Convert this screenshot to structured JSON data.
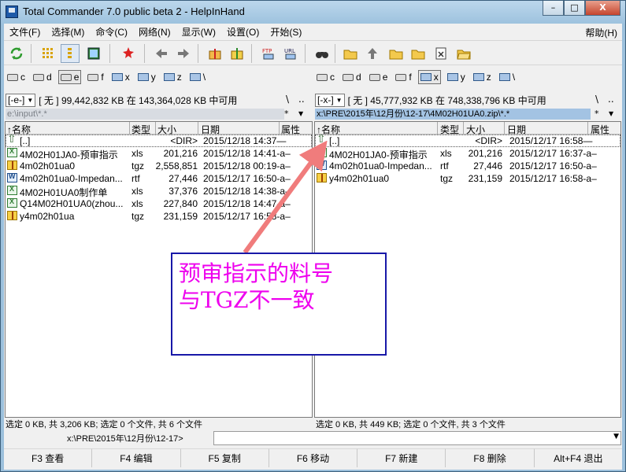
{
  "window": {
    "title": "Total Commander 7.0 public beta 2 - HelpInHand",
    "controls": {
      "minimize": "–",
      "maximize": "□",
      "close": "X"
    }
  },
  "menu": {
    "items": [
      "文件(F)",
      "选择(M)",
      "命令(C)",
      "网络(N)",
      "显示(W)",
      "设置(O)",
      "开始(S)"
    ],
    "help": "帮助(H)"
  },
  "toolbar": {
    "icons": [
      "refresh-icon",
      "brief-view-icon",
      "full-view-icon",
      "thumbnail-icon",
      "select-files-icon",
      "back-icon",
      "forward-icon",
      "pack-icon",
      "unpack-icon",
      "ftp-connect-icon",
      "url-icon",
      "find-files-icon",
      "folder-1-icon",
      "folder-up-icon",
      "folder-2-icon",
      "folder-3-icon",
      "notepad-icon",
      "folder-open-icon"
    ],
    "ftp_label": "FTP",
    "url_label": "URL"
  },
  "left": {
    "drives": [
      "c",
      "d",
      "e",
      "f",
      "x",
      "y",
      "z",
      "\\"
    ],
    "active_drive": "e",
    "drive_combo": "[-e-]",
    "volume": "[ 无 ]",
    "free_space": "99,442,832 KB 在 143,364,028 KB 中可用",
    "backslash": "\\",
    "dotdot": "..",
    "path": "e:\\input\\*.*",
    "star": "*",
    "columns": {
      "name": "↑名称",
      "type": "类型",
      "size": "大小",
      "date": "日期",
      "attr": "属性"
    },
    "files": [
      {
        "name": "[..]",
        "type": "",
        "size": "<DIR>",
        "date": "2015/12/18 14:37—",
        "icon": "up"
      },
      {
        "name": "4M02H01JA0-预审指示",
        "type": "xls",
        "size": "201,216",
        "date": "2015/12/18 14:41-a–",
        "icon": "xls"
      },
      {
        "name": "4m02h01ua0",
        "type": "tgz",
        "size": "2,558,851",
        "date": "2015/12/18 00:19-a–",
        "icon": "tgz"
      },
      {
        "name": "4m02h01ua0-Impedan...",
        "type": "rtf",
        "size": "27,446",
        "date": "2015/12/17 16:50-a–",
        "icon": "rtf"
      },
      {
        "name": "4M02H01UA0制作单",
        "type": "xls",
        "size": "37,376",
        "date": "2015/12/18 14:38-a–",
        "icon": "xls"
      },
      {
        "name": "Q14M02H01UA0(zhou...",
        "type": "xls",
        "size": "227,840",
        "date": "2015/12/18 14:47-a–",
        "icon": "xls"
      },
      {
        "name": "y4m02h01ua",
        "type": "tgz",
        "size": "231,159",
        "date": "2015/12/17 16:58-a–",
        "icon": "tgz"
      }
    ],
    "status": "选定 0 KB, 共 3,206 KB; 选定 0 个文件, 共 6 个文件"
  },
  "right": {
    "drives": [
      "c",
      "d",
      "e",
      "f",
      "x",
      "y",
      "z",
      "\\"
    ],
    "active_drive": "x",
    "drive_combo": "[-x-]",
    "volume": "[ 无 ]",
    "free_space": "45,777,932 KB 在 748,338,796 KB 中可用",
    "backslash": "\\",
    "dotdot": "..",
    "path": "x:\\PRE\\2015年\\12月份\\12-17\\4M02H01UA0.zip\\*.*",
    "star": "*",
    "columns": {
      "name": "↑名称",
      "type": "类型",
      "size": "大小",
      "date": "日期",
      "attr": "属性"
    },
    "files": [
      {
        "name": "[..]",
        "type": "",
        "size": "<DIR>",
        "date": "2015/12/17 16:58—",
        "icon": "up"
      },
      {
        "name": "4M02H01JA0-预审指示",
        "type": "xls",
        "size": "201,216",
        "date": "2015/12/17 16:37-a–",
        "icon": "xls"
      },
      {
        "name": "4m02h01ua0-Impedan...",
        "type": "rtf",
        "size": "27,446",
        "date": "2015/12/17 16:50-a–",
        "icon": "rtf"
      },
      {
        "name": "y4m02h01ua0",
        "type": "tgz",
        "size": "231,159",
        "date": "2015/12/17 16:58-a–",
        "icon": "tgz"
      }
    ],
    "status": "选定 0 KB, 共 449 KB; 选定 0 个文件, 共 3 个文件"
  },
  "command": {
    "path": "x:\\PRE\\2015年\\12月份\\12-17>",
    "value": ""
  },
  "fkeys": [
    "F3 查看",
    "F4 编辑",
    "F5 复制",
    "F6 移动",
    "F7 新建",
    "F8 删除",
    "Alt+F4 退出"
  ],
  "annotation": {
    "text": "预审指示的料号\n与TGZ不一致",
    "color": "#ee00ee",
    "border": "#1818a8",
    "arrow_color": "#f07c7c"
  }
}
